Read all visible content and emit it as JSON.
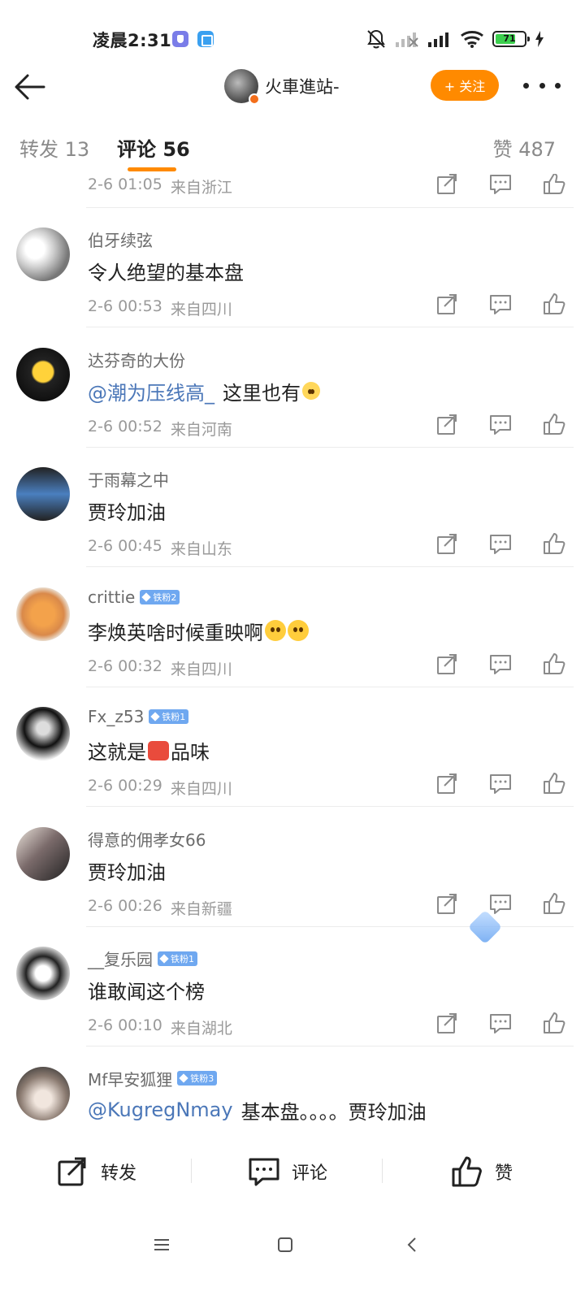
{
  "status_bar": {
    "time": "凌晨2:31",
    "battery": "71",
    "battery_fraction": 0.71
  },
  "header": {
    "author_name": "火車進站-",
    "follow_label": "+ 关注"
  },
  "tabs": {
    "repost": "转发 13",
    "comment": "评论 56",
    "like": "赞 487"
  },
  "partial_comment": {
    "time": "2-6 01:05",
    "location": "来自浙江"
  },
  "comments": [
    {
      "user": "伯牙续弦",
      "badge": "",
      "mention": "",
      "text": "令人绝望的基本盘",
      "time": "2-6 00:53",
      "location": "来自四川"
    },
    {
      "user": "达芬奇的大份",
      "badge": "",
      "mention": "@潮为压线高_",
      "text": "这里也有",
      "time": "2-6 00:52",
      "location": "来自河南"
    },
    {
      "user": "于雨幕之中",
      "badge": "",
      "mention": "",
      "text": "贾玲加油",
      "time": "2-6 00:45",
      "location": "来自山东"
    },
    {
      "user": "crittie",
      "badge": "铁粉2",
      "mention": "",
      "text": "李焕英啥时候重映啊",
      "time": "2-6 00:32",
      "location": "来自四川"
    },
    {
      "user": "Fx_z53",
      "badge": "铁粉1",
      "mention": "",
      "text_before": "这就是",
      "text": "品味",
      "time": "2-6 00:29",
      "location": "来自四川"
    },
    {
      "user": "得意的佣孝女66",
      "badge": "",
      "mention": "",
      "text": "贾玲加油",
      "time": "2-6 00:26",
      "location": "来自新疆"
    },
    {
      "user": "__复乐园",
      "badge": "铁粉1",
      "mention": "",
      "text": "谁敢闻这个榜",
      "time": "2-6 00:10",
      "location": "来自湖北"
    },
    {
      "user": "Mf早安狐狸",
      "badge": "铁粉3",
      "mention": "@KugregNmay",
      "text": "基本盘。。。。贾玲加油",
      "time": "",
      "location": ""
    }
  ],
  "bottom_bar": {
    "repost": "转发",
    "comment": "评论",
    "like": "赞"
  },
  "colors": {
    "accent": "#ff8a00",
    "mention": "#4b77b8",
    "meta": "#9a9a9a",
    "badge": "#6fa8f0"
  },
  "icons": [
    "back-arrow-icon",
    "more-icon",
    "repost-icon",
    "comment-icon",
    "like-icon",
    "menu-icon",
    "home-icon",
    "nav-back-icon"
  ]
}
